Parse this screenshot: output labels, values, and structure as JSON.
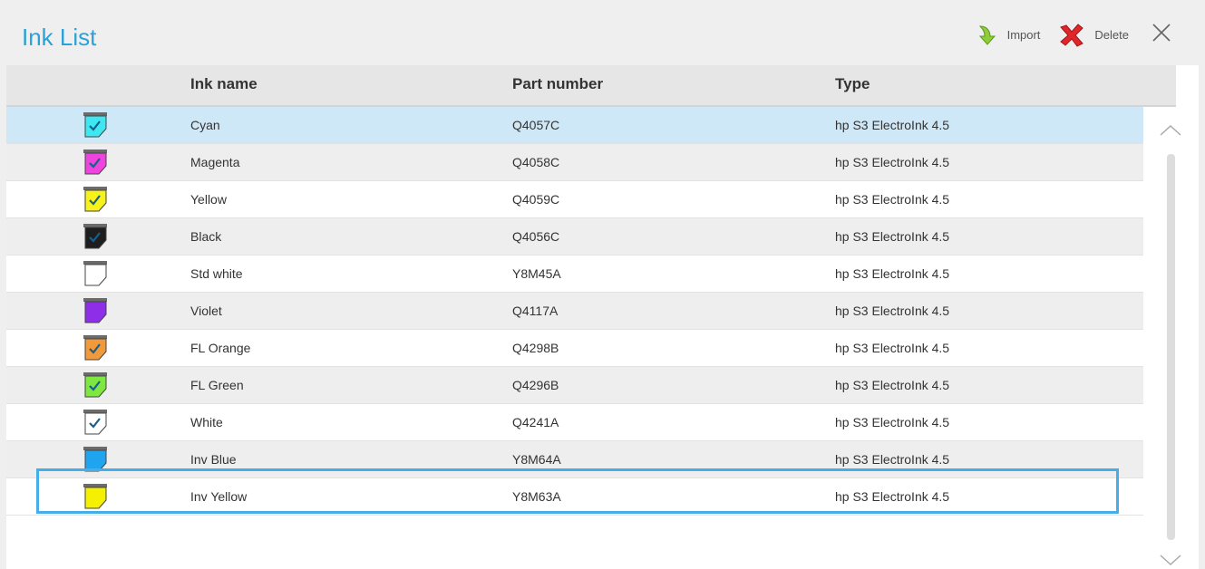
{
  "header": {
    "title": "Ink List",
    "import_label": "Import",
    "delete_label": "Delete"
  },
  "columns": {
    "ink_name": "Ink name",
    "part_number": "Part number",
    "type": "Type"
  },
  "rows": [
    {
      "name": "Cyan",
      "part": "Q4057C",
      "type": "hp S3 ElectroInk 4.5",
      "color": "#3ee8f2",
      "check": true
    },
    {
      "name": "Magenta",
      "part": "Q4058C",
      "type": "hp S3 ElectroInk 4.5",
      "color": "#ee44dd",
      "check": true
    },
    {
      "name": "Yellow",
      "part": "Q4059C",
      "type": "hp S3 ElectroInk 4.5",
      "color": "#f6f21a",
      "check": true
    },
    {
      "name": "Black",
      "part": "Q4056C",
      "type": "hp S3 ElectroInk 4.5",
      "color": "#1e1e1e",
      "check": true
    },
    {
      "name": "Std white",
      "part": "Y8M45A",
      "type": "hp S3 ElectroInk 4.5",
      "color": "#ffffff",
      "check": false
    },
    {
      "name": "Violet",
      "part": "Q4117A",
      "type": "hp S3 ElectroInk 4.5",
      "color": "#8e2ee8",
      "check": false
    },
    {
      "name": "FL Orange",
      "part": "Q4298B",
      "type": "hp S3 ElectroInk 4.5",
      "color": "#f29a3a",
      "check": true
    },
    {
      "name": "FL Green",
      "part": "Q4296B",
      "type": "hp S3 ElectroInk 4.5",
      "color": "#7ee840",
      "check": true
    },
    {
      "name": "White",
      "part": "Q4241A",
      "type": "hp S3 ElectroInk 4.5",
      "color": "#ffffff",
      "check": true
    },
    {
      "name": "Inv Blue",
      "part": "Y8M64A",
      "type": "hp S3 ElectroInk 4.5",
      "color": "#1fa4ef",
      "check": false
    },
    {
      "name": "Inv Yellow",
      "part": "Y8M63A",
      "type": "hp S3 ElectroInk 4.5",
      "color": "#f4f000",
      "check": false
    }
  ],
  "colors": {
    "accent": "#2aa2d8",
    "selected_row": "#cfe8f7",
    "focus_border": "#44aee8"
  }
}
